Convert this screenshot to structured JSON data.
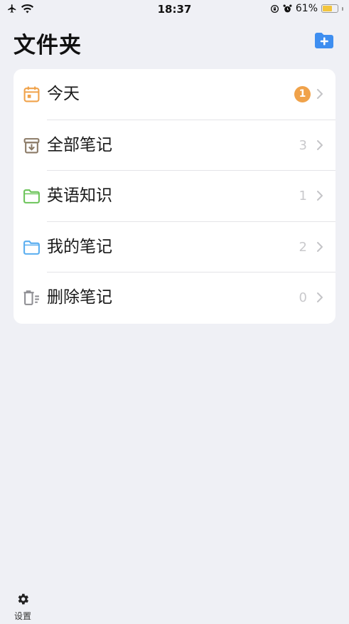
{
  "status": {
    "time": "18:37",
    "battery": "61%",
    "battery_level": 0.61
  },
  "header": {
    "title": "文件夹"
  },
  "folders": [
    {
      "label": "今天",
      "count": "1",
      "icon": "calendar-icon",
      "color": "#f0a24a"
    },
    {
      "label": "全部笔记",
      "count": "3",
      "icon": "archive-box-icon",
      "color": "#8b7a66"
    },
    {
      "label": "英语知识",
      "count": "1",
      "icon": "folder-icon",
      "color": "#6cc45a"
    },
    {
      "label": "我的笔记",
      "count": "2",
      "icon": "folder-icon",
      "color": "#5aaef0"
    },
    {
      "label": "删除笔记",
      "count": "0",
      "icon": "trash-icon",
      "color": "#8e8e93"
    }
  ],
  "toolbar": {
    "settings_label": "设置"
  },
  "colors": {
    "accent": "#3e8ef0",
    "badge": "#f0a24a",
    "background": "#eff0f5"
  }
}
